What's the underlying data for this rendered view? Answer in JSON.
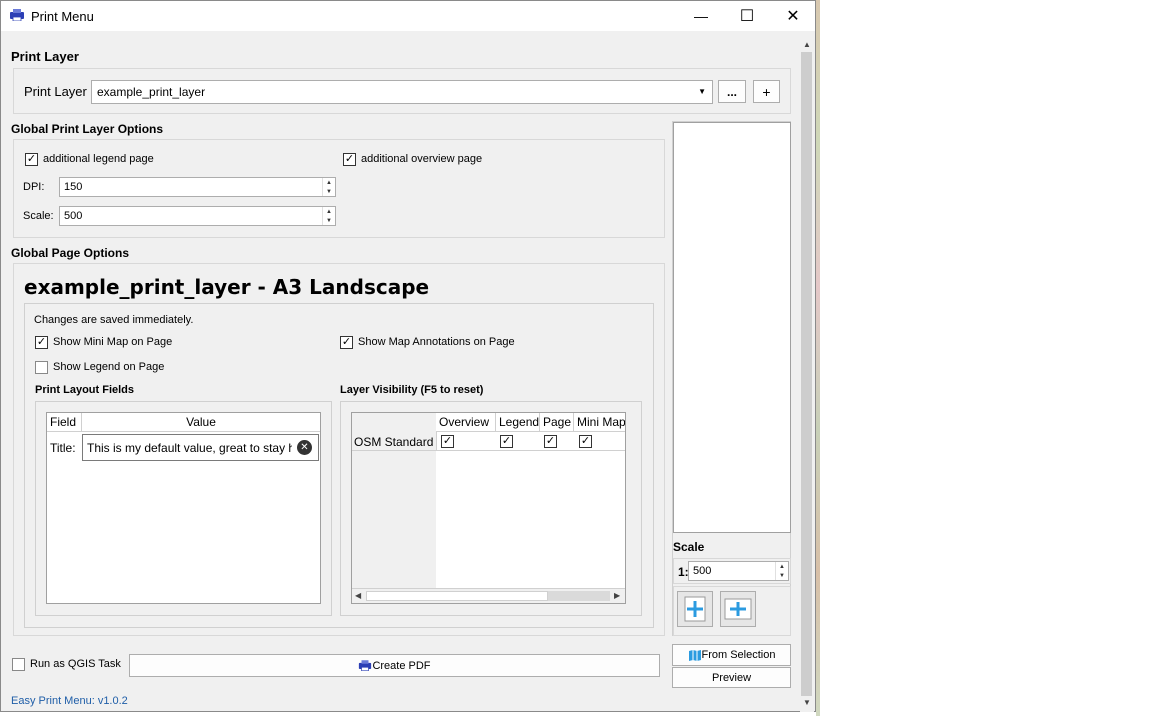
{
  "window": {
    "title": "Print Menu",
    "controls": {
      "minimize": "—",
      "maximize": "☐",
      "close": "✕"
    }
  },
  "print_layer": {
    "section_title": "Print Layer",
    "label": "Print Layer",
    "selected": "example_print_layer",
    "more_button": "...",
    "add_button": "+"
  },
  "global_options": {
    "section_title": "Global Print Layer Options",
    "legend_page_label": "additional legend page",
    "overview_page_label": "additional overview page",
    "legend_page_checked": true,
    "overview_page_checked": true,
    "dpi_label": "DPI:",
    "dpi_value": "150",
    "scale_label": "Scale:",
    "scale_value": "500"
  },
  "page_options": {
    "section_title": "Global Page Options",
    "page_heading": "example_print_layer - A3 Landscape",
    "saved_note": "Changes are saved immediately.",
    "mini_map_label": "Show Mini Map on Page",
    "mini_map_checked": true,
    "annotations_label": "Show Map Annotations on Page",
    "annotations_checked": true,
    "legend_label": "Show Legend on Page",
    "legend_checked": false,
    "fields_title": "Print Layout Fields",
    "fields_columns": [
      "Field",
      "Value"
    ],
    "fields_rows": [
      {
        "field": "Title:",
        "value": "This is my default value, great to stay he"
      }
    ],
    "visibility_title": "Layer Visibility (F5 to reset)",
    "visibility_columns": [
      "Overview",
      "Legend",
      "Page",
      "Mini Map"
    ],
    "visibility_rows": [
      {
        "layer": "OSM Standard",
        "overview": true,
        "legend": true,
        "page": true,
        "mini_map": true
      }
    ]
  },
  "side_panel": {
    "scale_title": "Scale",
    "scale_prefix": "1:",
    "scale_value": "500",
    "from_selection": "From Selection",
    "preview": "Preview"
  },
  "bottom": {
    "run_as_task_label": "Run as QGIS Task",
    "run_as_task_checked": false,
    "create_pdf": "Create PDF",
    "version": "Easy Print Menu: v1.0.2"
  },
  "colors": {
    "accent": "#1f5ea8",
    "version_text": "#1f5ea8",
    "icon_blue": "#2b9be0"
  }
}
